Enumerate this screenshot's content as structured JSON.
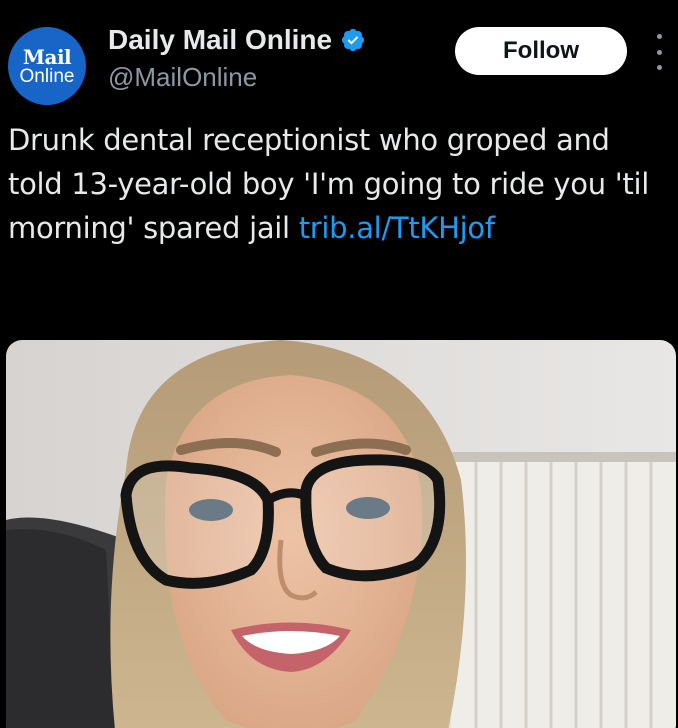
{
  "account": {
    "avatar_logo_top": "Mail",
    "avatar_logo_bottom": "Online",
    "display_name": "Daily Mail Online",
    "handle": "@MailOnline",
    "verified": true
  },
  "actions": {
    "follow_label": "Follow",
    "more_icon": "more-vertical-icon"
  },
  "tweet": {
    "text": "Drunk dental receptionist who groped and told 13-year-old boy 'I'm going to ride you 'til morning' spared jail ",
    "link_text": "trib.al/TtKHjof"
  },
  "colors": {
    "background": "#000000",
    "text": "#e7e9ea",
    "secondary_text": "#8b98a5",
    "link": "#1d9bf0",
    "avatar_bg": "#1765c6",
    "verified_badge": "#1d9bf0"
  }
}
